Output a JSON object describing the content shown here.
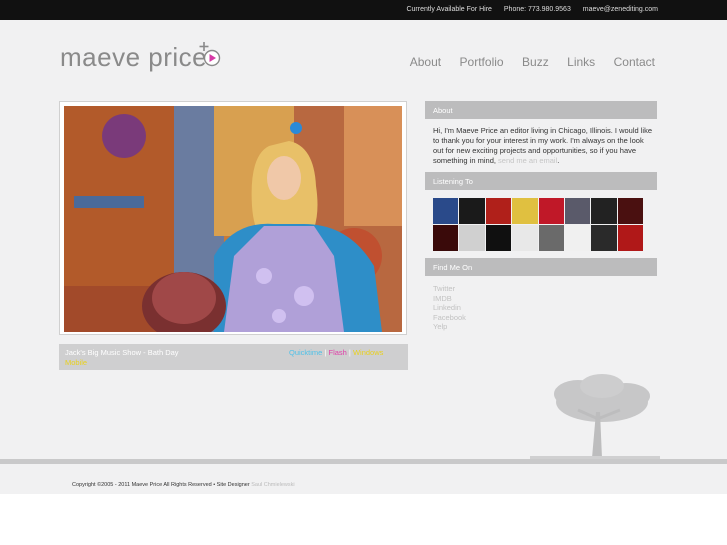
{
  "topbar": {
    "availability": "Currently Available For Hire",
    "phone": "Phone: 773.980.9563",
    "email": "maeve@zenediting.com"
  },
  "logo": {
    "text": "maeve price"
  },
  "nav": {
    "items": [
      "About",
      "Portfolio",
      "Buzz",
      "Links",
      "Contact"
    ]
  },
  "video": {
    "title": "Jack's Big Music Show - Bath Day",
    "link_quicktime": "Quicktime",
    "link_flash": "Flash",
    "link_windows": "Windows",
    "separator": "|",
    "link_mobile": "Mobile"
  },
  "sidebar": {
    "about_heading": "About",
    "about_text": "Hi, I'm Maeve Price an editor living in Chicago, Illinois. I would like to thank you for your interest in my work. I'm always on the look out for new exciting projects and opportunities, so if you have something in mind,",
    "about_link": "send me an email",
    "about_end": ".",
    "listening_heading": "Listening To",
    "album_colors": [
      "#2a4a8a",
      "#1a1a1a",
      "#b0201a",
      "#e0c040",
      "#c01828",
      "#5a5a6a",
      "#222222",
      "#4a1010",
      "#3a0a0a",
      "#d0d0d0",
      "#101010",
      "#e8e8e8",
      "#6a6a6a",
      "#f0f0f0",
      "#2a2a2a",
      "#b01818"
    ],
    "findme_heading": "Find Me On",
    "social": [
      "Twitter",
      "IMDB",
      "Linkedin",
      "Facebook",
      "Yelp"
    ]
  },
  "footer": {
    "copyright": "Copyright ©2005 - 2011 Maeve Price All Rights Reserved • Site Designer",
    "designer": "Saul Chmielewski"
  }
}
